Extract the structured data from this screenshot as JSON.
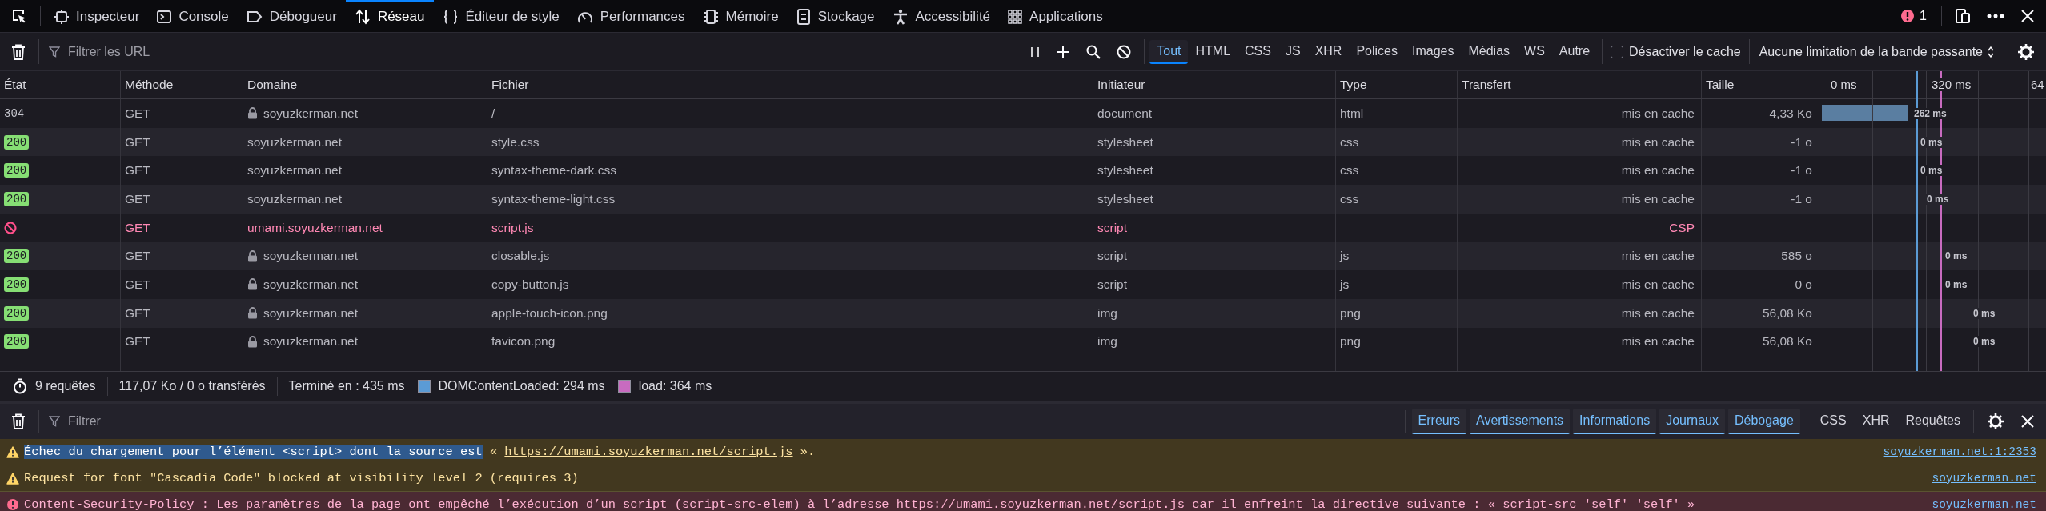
{
  "toolbox_tabs": [
    {
      "kind": "inspector",
      "label": "Inspecteur",
      "selected": false
    },
    {
      "kind": "console",
      "label": "Console",
      "selected": false
    },
    {
      "kind": "debugger",
      "label": "Débogueur",
      "selected": false
    },
    {
      "kind": "network",
      "label": "Réseau",
      "selected": true
    },
    {
      "kind": "style",
      "label": "Éditeur de style",
      "selected": false
    },
    {
      "kind": "performance",
      "label": "Performances",
      "selected": false
    },
    {
      "kind": "memory",
      "label": "Mémoire",
      "selected": false
    },
    {
      "kind": "storage",
      "label": "Stockage",
      "selected": false
    },
    {
      "kind": "accessibility",
      "label": "Accessibilité",
      "selected": false
    },
    {
      "kind": "applications",
      "label": "Applications",
      "selected": false
    }
  ],
  "error_count": "1",
  "network_toolbar": {
    "filter_placeholder": "Filtrer les URL",
    "type_filters": [
      {
        "label": "Tout",
        "selected": true
      },
      {
        "label": "HTML",
        "selected": false
      },
      {
        "label": "CSS",
        "selected": false
      },
      {
        "label": "JS",
        "selected": false
      },
      {
        "label": "XHR",
        "selected": false
      },
      {
        "label": "Polices",
        "selected": false
      },
      {
        "label": "Images",
        "selected": false
      },
      {
        "label": "Médias",
        "selected": false
      },
      {
        "label": "WS",
        "selected": false
      },
      {
        "label": "Autre",
        "selected": false
      }
    ],
    "disable_cache": {
      "label": "Désactiver le cache",
      "checked": false
    },
    "throttling": "Aucune limitation de la bande passante"
  },
  "table": {
    "columns": [
      "État",
      "Méthode",
      "Domaine",
      "Fichier",
      "Initiateur",
      "Type",
      "Transfert",
      "Taille"
    ],
    "waterfall_ticks": [
      "0 ms",
      "320 ms",
      "64"
    ],
    "rows": [
      {
        "kind": "cached",
        "status": "304",
        "method": "GET",
        "secure": true,
        "domain": "soyuzkerman.net",
        "file": "/",
        "initiator": "document",
        "type": "html",
        "transfer": "mis en cache",
        "size": "4,33 Ko",
        "timing": "262 ms"
      },
      {
        "kind": "ok",
        "status": "200",
        "method": "GET",
        "secure": false,
        "domain": "soyuzkerman.net",
        "file": "style.css",
        "initiator": "stylesheet",
        "type": "css",
        "transfer": "mis en cache",
        "size": "-1 o",
        "timing": "0 ms"
      },
      {
        "kind": "ok",
        "status": "200",
        "method": "GET",
        "secure": false,
        "domain": "soyuzkerman.net",
        "file": "syntax-theme-dark.css",
        "initiator": "stylesheet",
        "type": "css",
        "transfer": "mis en cache",
        "size": "-1 o",
        "timing": "0 ms"
      },
      {
        "kind": "ok",
        "status": "200",
        "method": "GET",
        "secure": false,
        "domain": "soyuzkerman.net",
        "file": "syntax-theme-light.css",
        "initiator": "stylesheet",
        "type": "css",
        "transfer": "mis en cache",
        "size": "-1 o",
        "timing": "0 ms"
      },
      {
        "kind": "blocked",
        "method": "GET",
        "secure": false,
        "domain": "umami.soyuzkerman.net",
        "file": "script.js",
        "initiator": "script",
        "transfer": "CSP"
      },
      {
        "kind": "ok",
        "status": "200",
        "method": "GET",
        "secure": true,
        "domain": "soyuzkerman.net",
        "file": "closable.js",
        "initiator": "script",
        "type": "js",
        "transfer": "mis en cache",
        "size": "585 o",
        "timing": "0 ms"
      },
      {
        "kind": "ok",
        "status": "200",
        "method": "GET",
        "secure": true,
        "domain": "soyuzkerman.net",
        "file": "copy-button.js",
        "initiator": "script",
        "type": "js",
        "transfer": "mis en cache",
        "size": "0 o",
        "timing": "0 ms"
      },
      {
        "kind": "ok",
        "status": "200",
        "method": "GET",
        "secure": true,
        "domain": "soyuzkerman.net",
        "file": "apple-touch-icon.png",
        "initiator": "img",
        "type": "png",
        "transfer": "mis en cache",
        "size": "56,08 Ko",
        "timing": "0 ms"
      },
      {
        "kind": "ok",
        "status": "200",
        "method": "GET",
        "secure": true,
        "domain": "soyuzkerman.net",
        "file": "favicon.png",
        "initiator": "img",
        "type": "png",
        "transfer": "mis en cache",
        "size": "56,08 Ko",
        "timing": "0 ms"
      }
    ]
  },
  "status_bar": {
    "requests": "9 requêtes",
    "transferred": "117,07 Ko / 0 o transférés",
    "finished": "Terminé en : 435 ms",
    "dom_content_loaded": "DOMContentLoaded: 294 ms",
    "load": "load: 364 ms"
  },
  "console": {
    "filter_placeholder": "Filtrer",
    "level_filters": [
      {
        "label": "Erreurs",
        "selected": true
      },
      {
        "label": "Avertissements",
        "selected": true
      },
      {
        "label": "Informations",
        "selected": true
      },
      {
        "label": "Journaux",
        "selected": true
      },
      {
        "label": "Débogage",
        "selected": true
      }
    ],
    "type_filters": [
      {
        "label": "CSS",
        "selected": false
      },
      {
        "label": "XHR",
        "selected": false
      },
      {
        "label": "Requêtes",
        "selected": false
      }
    ],
    "messages": [
      {
        "kind": "warning",
        "parts": [
          {
            "kind": "selected",
            "text": "Échec du chargement pour l’élément <script> dont la source est"
          },
          {
            "kind": "text",
            "text": " « "
          },
          {
            "kind": "link",
            "text": "https://umami.soyuzkerman.net/script.js"
          },
          {
            "kind": "text",
            "text": " »."
          }
        ],
        "source": "soyuzkerman.net:1:2353"
      },
      {
        "kind": "warning",
        "parts": [
          {
            "kind": "text",
            "text": "Request for font \"Cascadia Code\" blocked at visibility level 2 (requires 3)"
          }
        ],
        "source": "soyuzkerman.net"
      },
      {
        "kind": "error",
        "parts": [
          {
            "kind": "text",
            "text": "Content-Security-Policy : Les paramètres de la page ont empêché l’exécution d’un script (script-src-elem) à l’adresse "
          },
          {
            "kind": "link",
            "text": "https://umami.soyuzkerman.net/script.js"
          },
          {
            "kind": "text",
            "text": " car il enfreint la directive suivante : « script-src 'self' 'self' »"
          }
        ],
        "source": "soyuzkerman.net"
      }
    ]
  }
}
